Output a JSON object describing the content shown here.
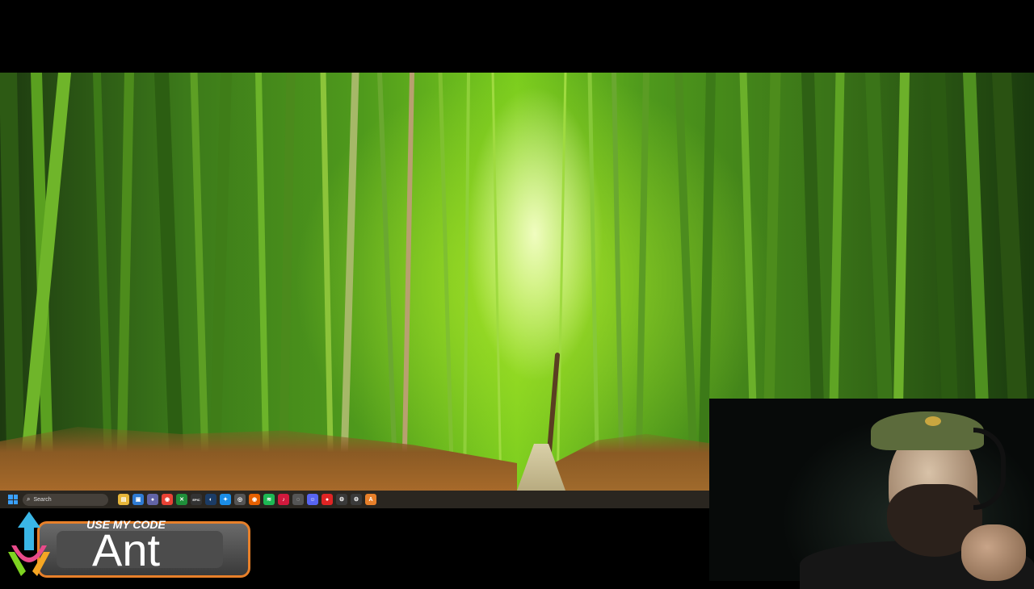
{
  "taskbar": {
    "search_placeholder": "Search",
    "icons": [
      {
        "name": "file-explorer-icon",
        "color": "#e7b63a",
        "glyph": "▤"
      },
      {
        "name": "photos-icon",
        "color": "#2f7bd3",
        "glyph": "▣"
      },
      {
        "name": "teams-icon",
        "color": "#6264a7",
        "glyph": "●"
      },
      {
        "name": "chrome-icon",
        "color": "#e94235",
        "glyph": "◉"
      },
      {
        "name": "xbox-icon",
        "color": "#1f8f3a",
        "glyph": "✕"
      },
      {
        "name": "epic-games-icon",
        "color": "#333333",
        "glyph": "EPIC"
      },
      {
        "name": "steam-icon",
        "color": "#1b3c66",
        "glyph": "◐"
      },
      {
        "name": "battlenet-icon",
        "color": "#1b8de6",
        "glyph": "✦"
      },
      {
        "name": "obs-icon",
        "color": "#555555",
        "glyph": "◎"
      },
      {
        "name": "firefox-icon",
        "color": "#e66000",
        "glyph": "◉"
      },
      {
        "name": "spotify-icon",
        "color": "#1db954",
        "glyph": "≋"
      },
      {
        "name": "tiktok-icon",
        "color": "#d1193d",
        "glyph": "♪"
      },
      {
        "name": "github-icon",
        "color": "#555555",
        "glyph": "◌"
      },
      {
        "name": "discord-icon",
        "color": "#5865f2",
        "glyph": "☺"
      },
      {
        "name": "record-icon",
        "color": "#e02424",
        "glyph": "●"
      },
      {
        "name": "settings-icon",
        "color": "#3a3a3a",
        "glyph": "⚙"
      },
      {
        "name": "gear-icon",
        "color": "#3a3a3a",
        "glyph": "⚙"
      },
      {
        "name": "app-icon",
        "color": "#e8802a",
        "glyph": "A"
      }
    ]
  },
  "promo": {
    "label": "USE MY CODE",
    "code": "Ant",
    "accent_color": "#e8802a"
  }
}
